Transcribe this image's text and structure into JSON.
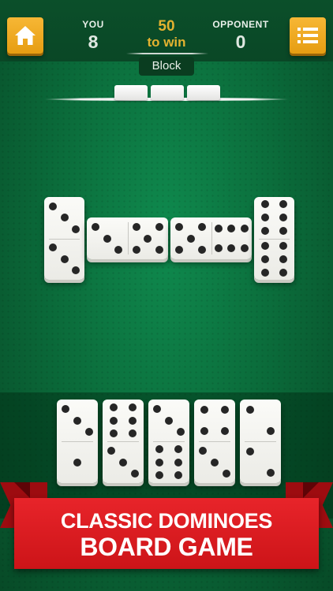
{
  "scoreboard": {
    "player_label": "YOU",
    "player_score": "8",
    "target_score": "50",
    "target_label": "to win",
    "opponent_label": "OPPONENT",
    "opponent_score": "0",
    "game_mode": "Block"
  },
  "icons": {
    "home": "home-icon",
    "menu": "menu-list-icon"
  },
  "colors": {
    "felt": "#0b6e3c",
    "button": "#f0a823",
    "target_text": "#e3b230",
    "banner": "#e01e23"
  },
  "boneyard": {
    "stock_tiles": 3
  },
  "board": {
    "tiles": [
      {
        "orientation": "vertical",
        "ends": [
          3,
          3
        ]
      },
      {
        "orientation": "horizontal",
        "ends": [
          3,
          5
        ]
      },
      {
        "orientation": "horizontal",
        "ends": [
          5,
          6
        ]
      },
      {
        "orientation": "vertical",
        "ends": [
          6,
          6
        ]
      }
    ]
  },
  "hand": {
    "tiles": [
      {
        "ends": [
          3,
          1
        ]
      },
      {
        "ends": [
          6,
          3
        ]
      },
      {
        "ends": [
          3,
          6
        ]
      },
      {
        "ends": [
          4,
          3
        ]
      },
      {
        "ends": [
          2,
          2
        ]
      }
    ]
  },
  "banner": {
    "line1": "CLASSIC DOMINOES",
    "line2": "BOARD GAME"
  }
}
